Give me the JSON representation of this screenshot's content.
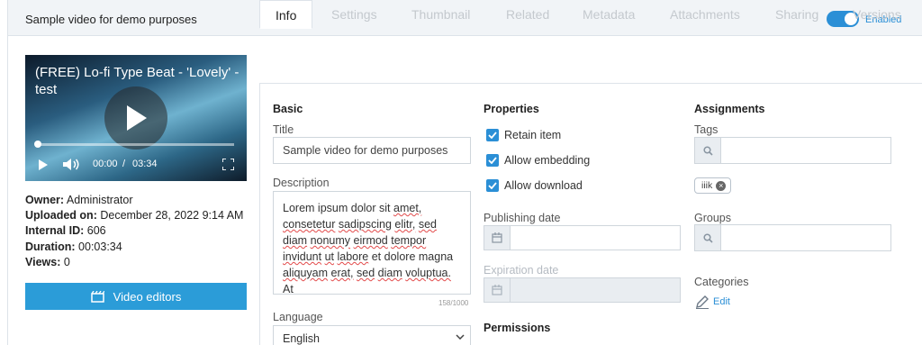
{
  "header": {
    "title": "Sample video for demo purposes",
    "toggle_label": "Enabled",
    "toggle_on": true
  },
  "player": {
    "video_title": "(FREE) Lo-fi Type Beat - 'Lovely' - test",
    "time_current": "00:00",
    "time_separator": "/",
    "time_total": "03:34",
    "progress": 0
  },
  "meta": {
    "owner_label": "Owner:",
    "owner": "Administrator",
    "uploaded_label": "Uploaded on:",
    "uploaded": "December 28, 2022 9:14 AM",
    "internal_id_label": "Internal ID:",
    "internal_id": "606",
    "duration_label": "Duration:",
    "duration": "00:03:34",
    "views_label": "Views:",
    "views": "0"
  },
  "video_editors_label": "Video editors",
  "tabs": [
    {
      "label": "Info",
      "active": true
    },
    {
      "label": "Settings"
    },
    {
      "label": "Thumbnail"
    },
    {
      "label": "Related"
    },
    {
      "label": "Metadata"
    },
    {
      "label": "Attachments"
    },
    {
      "label": "Sharing"
    },
    {
      "label": "Versions"
    }
  ],
  "basic": {
    "section_title": "Basic",
    "title_label": "Title",
    "title_value": "Sample video for demo purposes",
    "description_label": "Description",
    "description_words": [
      [
        "Lorem",
        "ipsum",
        "dolor",
        "sit",
        "amet,"
      ],
      [
        "consetetur",
        "sadipscing",
        "elitr,",
        "sed"
      ],
      [
        "diam",
        "nonumy",
        "eirmod",
        "tempor"
      ],
      [
        "invidunt",
        "ut",
        "labore",
        "et",
        "dolore",
        "magna"
      ],
      [
        "aliquyam",
        "erat,",
        "sed",
        "diam",
        "voluptua."
      ],
      [
        "At"
      ]
    ],
    "description_counter": "158/1000",
    "language_label": "Language",
    "language_value": "English"
  },
  "properties": {
    "section_title": "Properties",
    "retain_item": "Retain item",
    "allow_embedding": "Allow embedding",
    "allow_download": "Allow download",
    "publishing_date_label": "Publishing date",
    "expiration_date_label": "Expiration date",
    "permissions_title": "Permissions"
  },
  "assignments": {
    "section_title": "Assignments",
    "tags_label": "Tags",
    "tag_chip": "iiik",
    "groups_label": "Groups",
    "categories_label": "Categories",
    "edit_label": "Edit"
  },
  "colors": {
    "accent": "#2b8fd6",
    "button": "#2b9cd8",
    "misspelling": "#e24a4a"
  }
}
